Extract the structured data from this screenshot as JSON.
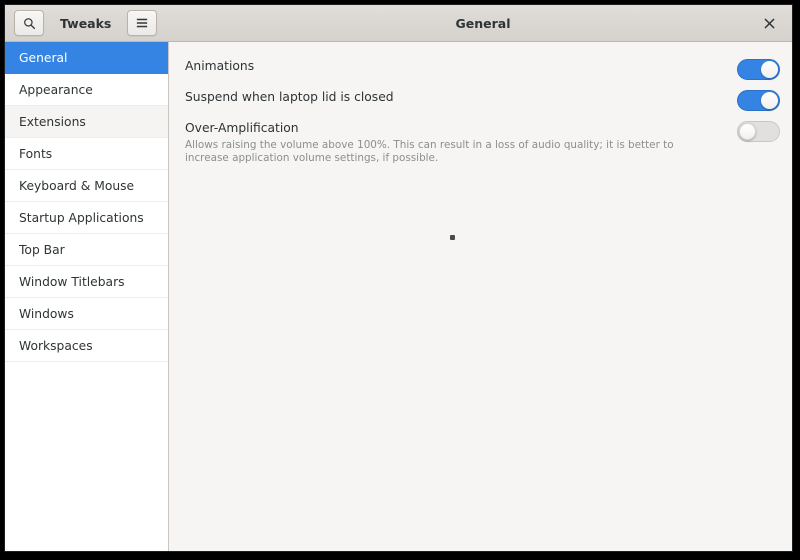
{
  "window": {
    "app_title": "Tweaks",
    "pane_title": "General",
    "search_icon": "search-icon",
    "menu_icon": "hamburger-menu-icon",
    "close_icon": "close-icon",
    "close_label": "×",
    "accent_color": "#3584e4",
    "sidebar_bg": "#ffffff",
    "content_bg": "#f6f5f4",
    "headerbar_bg": "#dad6d2"
  },
  "sidebar": {
    "items": [
      {
        "label": "General",
        "selected": true,
        "alt": false
      },
      {
        "label": "Appearance",
        "selected": false,
        "alt": false
      },
      {
        "label": "Extensions",
        "selected": false,
        "alt": true
      },
      {
        "label": "Fonts",
        "selected": false,
        "alt": false
      },
      {
        "label": "Keyboard & Mouse",
        "selected": false,
        "alt": false
      },
      {
        "label": "Startup Applications",
        "selected": false,
        "alt": false
      },
      {
        "label": "Top Bar",
        "selected": false,
        "alt": false
      },
      {
        "label": "Window Titlebars",
        "selected": false,
        "alt": false
      },
      {
        "label": "Windows",
        "selected": false,
        "alt": false
      },
      {
        "label": "Workspaces",
        "selected": false,
        "alt": false
      }
    ]
  },
  "main": {
    "settings": [
      {
        "title": "Animations",
        "description": "",
        "state": "on",
        "name": "animations"
      },
      {
        "title": "Suspend when laptop lid is closed",
        "description": "",
        "state": "on",
        "name": "suspend-when-lid-closed"
      },
      {
        "title": "Over-Amplification",
        "description": "Allows raising the volume above 100%. This can result in a loss of audio quality; it is better to increase application volume settings, if possible.",
        "state": "off",
        "name": "over-amplification"
      }
    ]
  }
}
